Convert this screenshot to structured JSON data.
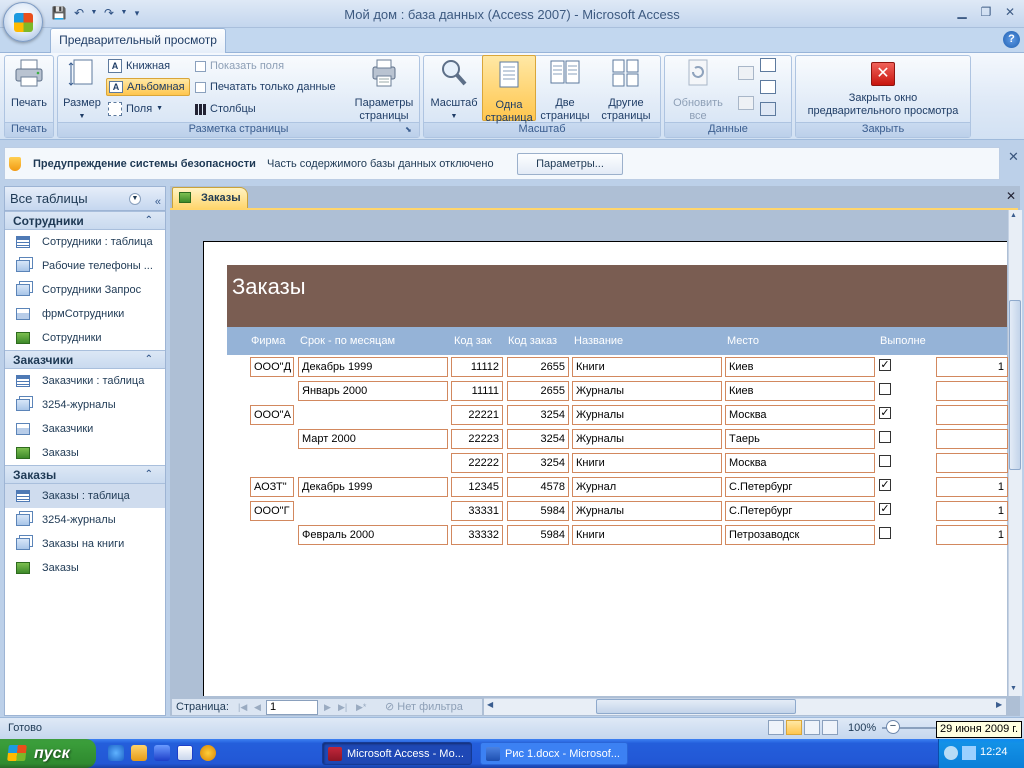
{
  "window": {
    "title": "Мой дом : база данных (Access 2007) - Microsoft Access"
  },
  "ribbon": {
    "tab": "Предварительный просмотр",
    "groups": {
      "print": {
        "label": "Печать",
        "print_btn": "Печать"
      },
      "layout": {
        "label": "Разметка страницы",
        "size_btn": "Размер",
        "portrait": "Книжная",
        "landscape": "Альбомная",
        "margins": "Поля",
        "show_fields": "Показать поля",
        "print_data_only": "Печатать только данные",
        "columns": "Столбцы",
        "page_setup_l1": "Параметры",
        "page_setup_l2": "страницы"
      },
      "zoom": {
        "label": "Масштаб",
        "zoom_btn": "Масштаб",
        "one_page_l1": "Одна",
        "one_page_l2": "страница",
        "two_pages_l1": "Две",
        "two_pages_l2": "страницы",
        "other_pages_l1": "Другие",
        "other_pages_l2": "страницы"
      },
      "data": {
        "label": "Данные",
        "refresh_l1": "Обновить",
        "refresh_l2": "все"
      },
      "close": {
        "label": "Закрыть",
        "close_l1": "Закрыть окно",
        "close_l2": "предварительного просмотра"
      }
    }
  },
  "security_bar": {
    "title": "Предупреждение системы безопасности",
    "message": "Часть содержимого базы данных отключено",
    "button": "Параметры..."
  },
  "nav": {
    "header": "Все таблицы",
    "groups": [
      {
        "name": "Сотрудники",
        "items": [
          {
            "label": "Сотрудники : таблица",
            "type": "table"
          },
          {
            "label": "Рабочие телефоны ...",
            "type": "query"
          },
          {
            "label": "Сотрудники Запрос",
            "type": "query"
          },
          {
            "label": "фрмСотрудники",
            "type": "form"
          },
          {
            "label": "Сотрудники",
            "type": "report"
          }
        ]
      },
      {
        "name": "Заказчики",
        "items": [
          {
            "label": "Заказчики : таблица",
            "type": "table"
          },
          {
            "label": "3254-журналы",
            "type": "query"
          },
          {
            "label": "Заказчики",
            "type": "form"
          },
          {
            "label": "Заказы",
            "type": "report"
          }
        ]
      },
      {
        "name": "Заказы",
        "items": [
          {
            "label": "Заказы : таблица",
            "type": "table",
            "selected": true
          },
          {
            "label": "3254-журналы",
            "type": "query"
          },
          {
            "label": "Заказы на книги",
            "type": "query"
          },
          {
            "label": "Заказы",
            "type": "report"
          }
        ]
      }
    ]
  },
  "doc_tab": {
    "label": "Заказы"
  },
  "report": {
    "title": "Заказы",
    "columns": [
      "Фирма",
      "Срок - по месяцам",
      "Код зак",
      "Код заказ",
      "Название",
      "Место",
      "Выполне"
    ],
    "rows": [
      {
        "firm": "ООО\"Д",
        "period": "Декабрь 1999",
        "code1": "11112",
        "code2": "2655",
        "name": "Книги",
        "place": "Киев",
        "done": true,
        "extra": "1"
      },
      {
        "firm": "",
        "period": "Январь 2000",
        "code1": "11111",
        "code2": "2655",
        "name": "Журналы",
        "place": "Киев",
        "done": false,
        "extra": ""
      },
      {
        "firm": "ООО\"А",
        "period": "",
        "code1": "22221",
        "code2": "3254",
        "name": "Журналы",
        "place": "Москва",
        "done": true,
        "extra": ""
      },
      {
        "firm": "",
        "period": "Март 2000",
        "code1": "22223",
        "code2": "3254",
        "name": "Журналы",
        "place": "Тaерь",
        "done": false,
        "extra": ""
      },
      {
        "firm": "",
        "period": "",
        "code1": "22222",
        "code2": "3254",
        "name": "Книги",
        "place": "Москва",
        "done": false,
        "extra": ""
      },
      {
        "firm": "АОЗТ\"",
        "period": "Декабрь 1999",
        "code1": "12345",
        "code2": "4578",
        "name": "Журнал",
        "place": "С.Петербург",
        "done": true,
        "extra": "1"
      },
      {
        "firm": "ООО\"Г",
        "period": "",
        "code1": "33331",
        "code2": "5984",
        "name": "Журналы",
        "place": "С.Петербург",
        "done": true,
        "extra": "1"
      },
      {
        "firm": "",
        "period": "Февраль 2000",
        "code1": "33332",
        "code2": "5984",
        "name": "Книги",
        "place": "Петрозаводск",
        "done": false,
        "extra": "1"
      }
    ]
  },
  "record_nav": {
    "label": "Страница:",
    "page": "1",
    "filter": "Нет фильтра"
  },
  "status": {
    "ready": "Готово",
    "zoom": "100%",
    "tooltip": "29 июня 2009 г."
  },
  "taskbar": {
    "start": "пуск",
    "tasks": [
      "Microsoft Access - Мо...",
      "Рис 1.docx - Microsof..."
    ],
    "clock": "12:24"
  }
}
